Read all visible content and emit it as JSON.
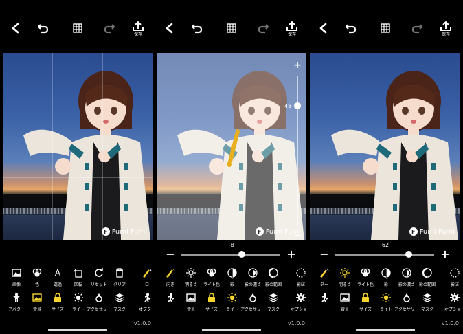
{
  "colors": {
    "accent": "#f7d531",
    "background": "#000000",
    "icon": "#ffffff"
  },
  "toolbar": {
    "save_label": "保存"
  },
  "watermark": {
    "logo": "F",
    "text": "Fumi Fumi"
  },
  "app": {
    "version": "v1.0.0"
  },
  "panels": [
    {
      "tools_row1": [
        {
          "label": "画像",
          "icon": "image-icon"
        },
        {
          "label": "色",
          "icon": "palette-icon"
        },
        {
          "label": "透過",
          "icon": "text-icon"
        },
        {
          "label": "回転",
          "icon": "rotate-frame-icon"
        },
        {
          "label": "リセット",
          "icon": "reset-icon"
        },
        {
          "label": "クリア",
          "icon": "trash-icon"
        },
        {
          "label": "ロ",
          "icon": "light-direction-icon"
        }
      ],
      "tools_row2": [
        {
          "label": "アバター",
          "icon": "avatar-icon"
        },
        {
          "label": "背景",
          "icon": "background-icon",
          "active": true
        },
        {
          "label": "サイズ",
          "icon": "lock-icon",
          "active": true
        },
        {
          "label": "ライト",
          "icon": "sun-icon"
        },
        {
          "label": "アクセサリー",
          "icon": "ring-icon"
        },
        {
          "label": "マスク",
          "icon": "layers-icon"
        },
        {
          "label": "オプター",
          "icon": "figure-icon"
        }
      ]
    },
    {
      "vertical_slider": {
        "value": "48",
        "level": 0.2
      },
      "horizontal_slider": {
        "value": "-8",
        "level": 0.61
      },
      "tools_row1": [
        {
          "label": "向き",
          "icon": "light-direction-icon",
          "active": true
        },
        {
          "label": "明るさ",
          "icon": "brightness-icon"
        },
        {
          "label": "ライト色",
          "icon": "palette-icon"
        },
        {
          "label": "影",
          "icon": "shadow-icon"
        },
        {
          "label": "影の濃さ",
          "icon": "shadow-density-icon"
        },
        {
          "label": "影の範囲",
          "icon": "shadow-range-icon"
        },
        {
          "label": "影ぼ",
          "icon": "shadow-blur-icon"
        }
      ],
      "tools_row2": [
        {
          "label": "",
          "icon": "figure-icon"
        },
        {
          "label": "背景",
          "icon": "background-icon"
        },
        {
          "label": "サイズ",
          "icon": "lock-icon",
          "active": true
        },
        {
          "label": "ライト",
          "icon": "sun-icon",
          "active": true
        },
        {
          "label": "アクセサリー",
          "icon": "ring-icon"
        },
        {
          "label": "マスク",
          "icon": "layers-icon"
        },
        {
          "label": "オプション",
          "icon": "gear-icon"
        }
      ]
    },
    {
      "horizontal_slider": {
        "value": "62",
        "level": 0.74
      },
      "tools_row1": [
        {
          "label": "ター",
          "icon": "light-direction-icon"
        },
        {
          "label": "明るさ",
          "icon": "brightness-icon",
          "active": true
        },
        {
          "label": "ライト色",
          "icon": "palette-icon"
        },
        {
          "label": "影",
          "icon": "shadow-icon"
        },
        {
          "label": "影の濃さ",
          "icon": "shadow-density-icon"
        },
        {
          "label": "影の範囲",
          "icon": "shadow-range-icon"
        },
        {
          "label": "影ぼ",
          "icon": "shadow-blur-icon"
        }
      ],
      "tools_row2": [
        {
          "label": "",
          "icon": "figure-icon"
        },
        {
          "label": "背景",
          "icon": "background-icon"
        },
        {
          "label": "サイズ",
          "icon": "lock-icon",
          "active": true
        },
        {
          "label": "ライト",
          "icon": "sun-icon",
          "active": true
        },
        {
          "label": "アクセサリー",
          "icon": "ring-icon"
        },
        {
          "label": "マスク",
          "icon": "layers-icon"
        },
        {
          "label": "オプション",
          "icon": "gear-icon"
        }
      ]
    }
  ]
}
